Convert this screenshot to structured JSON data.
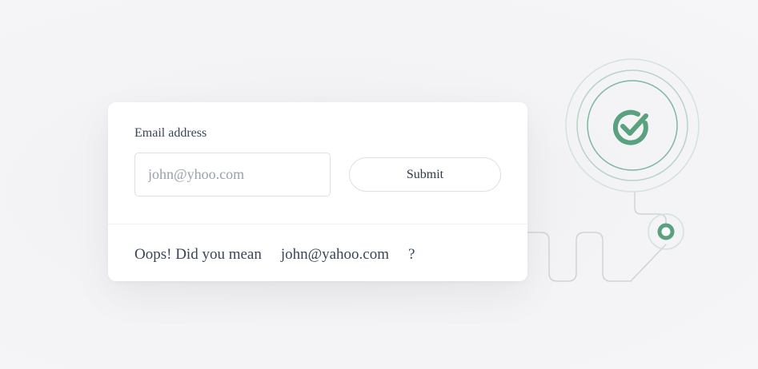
{
  "form": {
    "label": "Email address",
    "email_value": "",
    "email_placeholder": "john@yhoo.com",
    "submit_label": "Submit"
  },
  "suggestion": {
    "prefix": "Oops! Did you mean",
    "suggested_email": "john@yahoo.com",
    "suffix": "?"
  },
  "icons": {
    "success": "check-circle-icon",
    "connector_node": "node-ring-icon"
  },
  "colors": {
    "accent_green": "#5aa17f",
    "ring_light": "#d2e2dc",
    "connector_gray": "#cfd3d8",
    "text": "#3a4658",
    "placeholder": "#9aa1ac",
    "background": "#f4f4f6",
    "card": "#ffffff"
  }
}
